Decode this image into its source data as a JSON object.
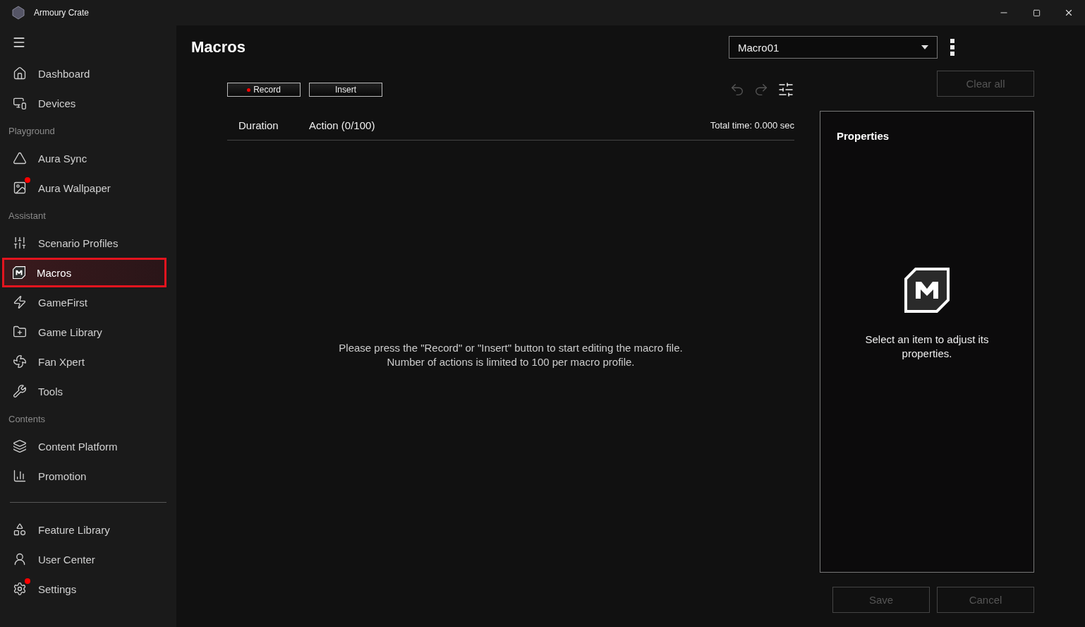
{
  "window": {
    "title": "Armoury Crate"
  },
  "sidebar": {
    "items": [
      {
        "kind": "item",
        "label": "Dashboard",
        "selected": false,
        "badge": false
      },
      {
        "kind": "item",
        "label": "Devices",
        "selected": false,
        "badge": false
      },
      {
        "kind": "section",
        "label": "Playground"
      },
      {
        "kind": "item",
        "label": "Aura Sync",
        "selected": false,
        "badge": false
      },
      {
        "kind": "item",
        "label": "Aura Wallpaper",
        "selected": false,
        "badge": true
      },
      {
        "kind": "section",
        "label": "Assistant"
      },
      {
        "kind": "item",
        "label": "Scenario Profiles",
        "selected": false,
        "badge": false
      },
      {
        "kind": "item",
        "label": "Macros",
        "selected": true,
        "badge": false
      },
      {
        "kind": "item",
        "label": "GameFirst",
        "selected": false,
        "badge": false
      },
      {
        "kind": "item",
        "label": "Game Library",
        "selected": false,
        "badge": false
      },
      {
        "kind": "item",
        "label": "Fan Xpert",
        "selected": false,
        "badge": false
      },
      {
        "kind": "item",
        "label": "Tools",
        "selected": false,
        "badge": false
      },
      {
        "kind": "section",
        "label": "Contents"
      },
      {
        "kind": "item",
        "label": "Content Platform",
        "selected": false,
        "badge": false
      },
      {
        "kind": "item",
        "label": "Promotion",
        "selected": false,
        "badge": false
      },
      {
        "kind": "divider"
      },
      {
        "kind": "item",
        "label": "Feature Library",
        "selected": false,
        "badge": false
      },
      {
        "kind": "item",
        "label": "User Center",
        "selected": false,
        "badge": false
      },
      {
        "kind": "item",
        "label": "Settings",
        "selected": false,
        "badge": true
      }
    ]
  },
  "page": {
    "title": "Macros",
    "profile": {
      "value": "Macro01"
    }
  },
  "toolbar": {
    "buttons": [
      {
        "label": "Record",
        "kind": "record"
      },
      {
        "label": "Insert",
        "kind": "plain"
      }
    ],
    "undo_disabled": true,
    "redo_disabled": true,
    "clear_all": {
      "label": "Clear all",
      "disabled": true
    }
  },
  "table": {
    "columns": [
      "Duration",
      "Action (0/100)"
    ],
    "total_time": "Total time: 0.000 sec",
    "empty_message": [
      "Please press the \"Record\" or \"Insert\" button to start editing the macro file.",
      "Number of actions is limited to 100 per macro profile."
    ]
  },
  "properties": {
    "title": "Properties",
    "hint": "Select an item to adjust its properties."
  },
  "footer_buttons": [
    {
      "label": "Save",
      "disabled": true
    },
    {
      "label": "Cancel",
      "disabled": true
    }
  ]
}
